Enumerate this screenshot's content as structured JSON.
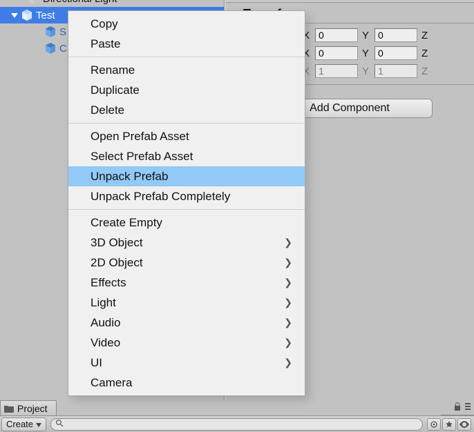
{
  "hierarchy": {
    "items": [
      {
        "label": "Directional Light",
        "indent": 24,
        "has_foldout": false,
        "icon": "gameobject",
        "color_selected": false,
        "truncated": true,
        "prefab": false
      },
      {
        "label": "Test",
        "indent": 14,
        "has_foldout": true,
        "foldout_open": true,
        "icon": "prefab",
        "color_selected": true,
        "prefab": true
      },
      {
        "label": "S",
        "indent": 48,
        "has_foldout": false,
        "icon": "prefab",
        "color_selected": false,
        "prefab": true
      },
      {
        "label": "C",
        "indent": 48,
        "has_foldout": false,
        "icon": "prefab",
        "color_selected": false,
        "prefab": true
      }
    ]
  },
  "context_menu": {
    "groups": [
      [
        {
          "label": "Copy"
        },
        {
          "label": "Paste"
        }
      ],
      [
        {
          "label": "Rename"
        },
        {
          "label": "Duplicate"
        },
        {
          "label": "Delete"
        }
      ],
      [
        {
          "label": "Open Prefab Asset"
        },
        {
          "label": "Select Prefab Asset"
        },
        {
          "label": "Unpack Prefab",
          "highlight": true
        },
        {
          "label": "Unpack Prefab Completely"
        }
      ],
      [
        {
          "label": "Create Empty"
        },
        {
          "label": "3D Object",
          "submenu": true
        },
        {
          "label": "2D Object",
          "submenu": true
        },
        {
          "label": "Effects",
          "submenu": true
        },
        {
          "label": "Light",
          "submenu": true
        },
        {
          "label": "Audio",
          "submenu": true
        },
        {
          "label": "Video",
          "submenu": true
        },
        {
          "label": "UI",
          "submenu": true
        },
        {
          "label": "Camera"
        }
      ]
    ]
  },
  "inspector": {
    "transform_title": "Transform",
    "rows": [
      {
        "x_label": "X",
        "x": "0",
        "y_label": "Y",
        "y": "0",
        "z_label": "Z",
        "dim": false
      },
      {
        "x_label": "X",
        "x": "0",
        "y_label": "Y",
        "y": "0",
        "z_label": "Z",
        "dim": false
      },
      {
        "x_label": "X",
        "x": "1",
        "y_label": "Y",
        "y": "1",
        "z_label": "Z",
        "dim": true
      }
    ],
    "add_component": "Add Component"
  },
  "project": {
    "tab_label": "Project",
    "create_label": "Create"
  }
}
